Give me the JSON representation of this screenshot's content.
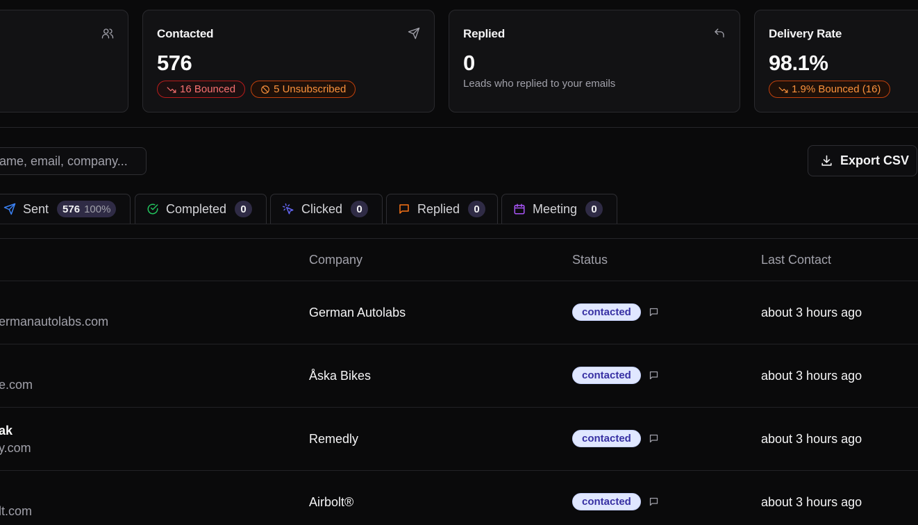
{
  "stats": {
    "contacted": {
      "title": "Contacted",
      "value": "576",
      "bounced_label": "16 Bounced",
      "unsub_label": "5 Unsubscribed"
    },
    "replied": {
      "title": "Replied",
      "value": "0",
      "subtitle": "Leads who replied to your emails"
    },
    "delivery": {
      "title": "Delivery Rate",
      "value": "98.1%",
      "bounced_label": "1.9% Bounced (16)"
    }
  },
  "search": {
    "placeholder": "ame, email, company..."
  },
  "export_label": "Export CSV",
  "tabs": [
    {
      "label": "Sent",
      "count": "576",
      "pct": "100%",
      "icon": "send-icon",
      "color": "#3b82f6"
    },
    {
      "label": "Completed",
      "count": "0",
      "icon": "check-circle-icon",
      "color": "#22c55e"
    },
    {
      "label": "Clicked",
      "count": "0",
      "icon": "cursor-click-icon",
      "color": "#6366f1"
    },
    {
      "label": "Replied",
      "count": "0",
      "icon": "message-icon",
      "color": "#f97316"
    },
    {
      "label": "Meeting",
      "count": "0",
      "icon": "calendar-icon",
      "color": "#a855f7"
    }
  ],
  "table": {
    "headers": {
      "company": "Company",
      "status": "Status",
      "last_contact": "Last Contact"
    },
    "rows": [
      {
        "name": "",
        "email": "ermanautolabs.com",
        "company": "German Autolabs",
        "status": "contacted",
        "last_contact": "about 3 hours ago"
      },
      {
        "name": "",
        "email": "e.com",
        "company": "Åska Bikes",
        "status": "contacted",
        "last_contact": "about 3 hours ago"
      },
      {
        "name": "ak",
        "email": "y.com",
        "company": "Remedly",
        "status": "contacted",
        "last_contact": "about 3 hours ago"
      },
      {
        "name": "",
        "email": "lt.com",
        "company": "Airbolt®",
        "status": "contacted",
        "last_contact": "about 3 hours ago"
      }
    ]
  }
}
